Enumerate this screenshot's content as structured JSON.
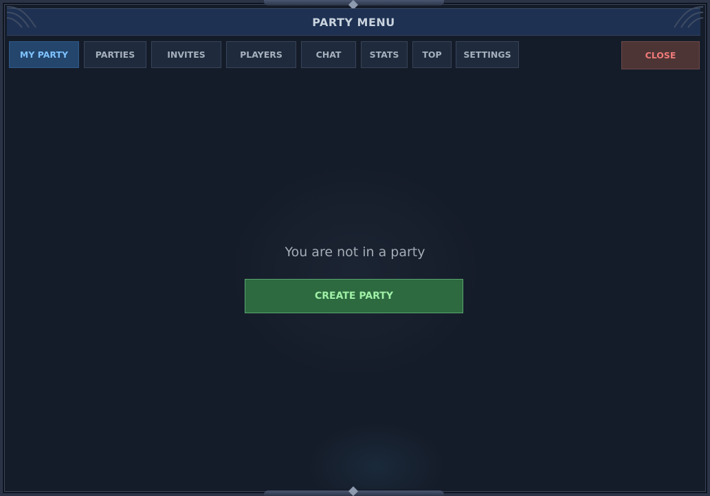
{
  "window": {
    "title": "PARTY MENU"
  },
  "tabs": [
    {
      "label": "MY PARTY",
      "active": true
    },
    {
      "label": "PARTIES",
      "active": false
    },
    {
      "label": "INVITES",
      "active": false
    },
    {
      "label": "PLAYERS",
      "active": false
    },
    {
      "label": "CHAT",
      "active": false
    },
    {
      "label": "STATS",
      "active": false
    },
    {
      "label": "TOP",
      "active": false
    },
    {
      "label": "SETTINGS",
      "active": false
    }
  ],
  "close_label": "CLOSE",
  "main": {
    "empty_message": "You are not in a party",
    "create_label": "CREATE PARTY"
  },
  "colors": {
    "header": "#1e3152",
    "active_tab": "#24466d",
    "active_tab_text": "#7ec2ff",
    "close": "#4e3535",
    "close_text": "#f07a7a",
    "create": "#2d6a3f",
    "create_text": "#9ff0a6"
  }
}
